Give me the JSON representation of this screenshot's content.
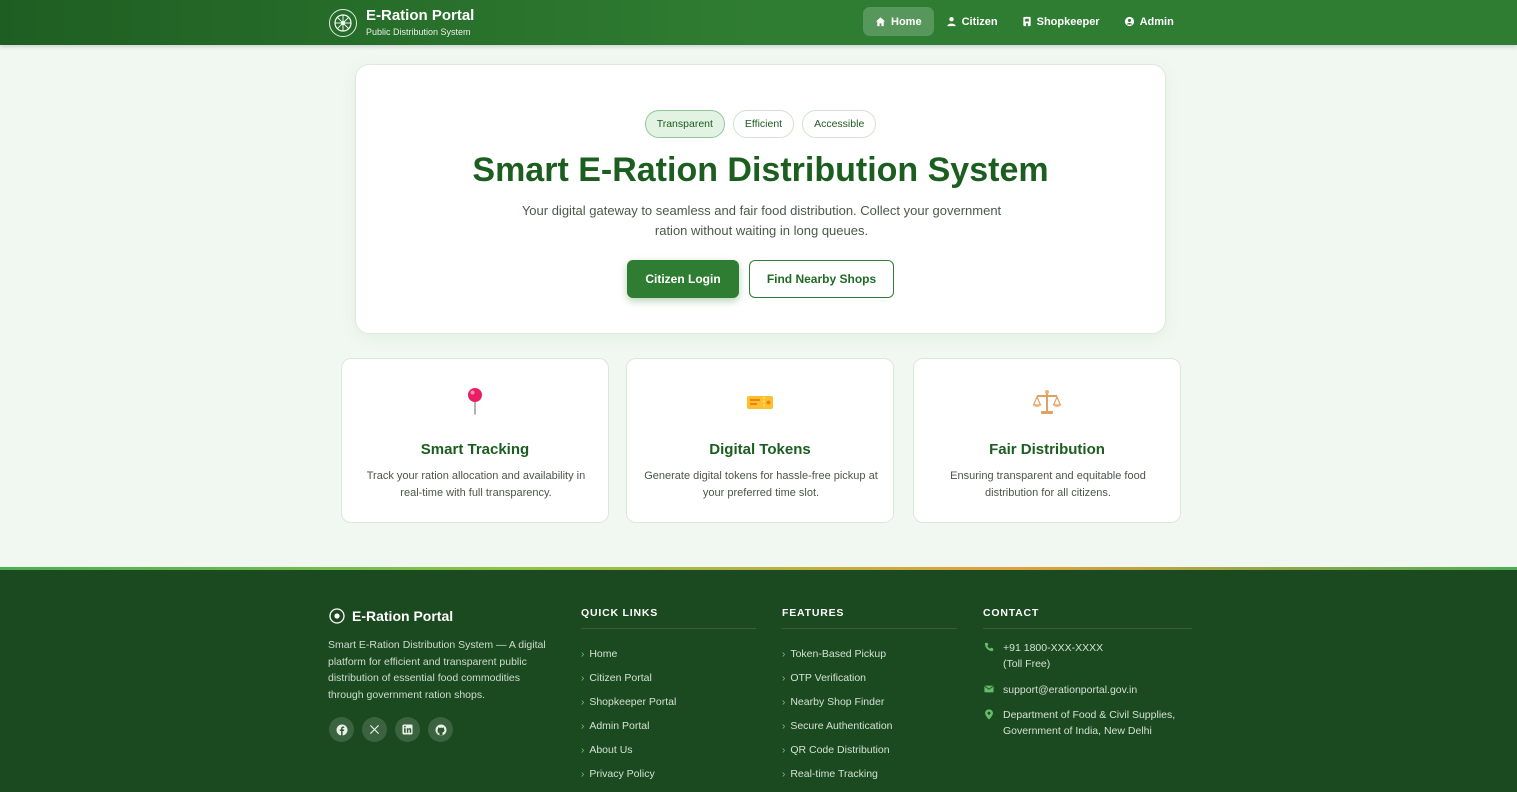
{
  "header": {
    "brand_title": "E-Ration Portal",
    "brand_subtitle": "Public Distribution System",
    "nav": [
      {
        "label": "Home",
        "active": true,
        "icon": "home-icon"
      },
      {
        "label": "Citizen",
        "active": false,
        "icon": "user-icon"
      },
      {
        "label": "Shopkeeper",
        "active": false,
        "icon": "store-icon"
      },
      {
        "label": "Admin",
        "active": false,
        "icon": "admin-icon"
      }
    ]
  },
  "hero": {
    "pills": [
      "Transparent",
      "Efficient",
      "Accessible"
    ],
    "title": "Smart E-Ration Distribution System",
    "description": "Your digital gateway to seamless and fair food distribution. Collect your government ration without waiting in long queues.",
    "primary_button": "Citizen Login",
    "secondary_button": "Find Nearby Shops"
  },
  "features": [
    {
      "icon": "pushpin-icon",
      "title": "Smart Tracking",
      "description": "Track your ration allocation and availability in real-time with full transparency."
    },
    {
      "icon": "ticket-icon",
      "title": "Digital Tokens",
      "description": "Generate digital tokens for hassle-free pickup at your preferred time slot."
    },
    {
      "icon": "balance-scale-icon",
      "title": "Fair Distribution",
      "description": "Ensuring transparent and equitable food distribution for all citizens."
    }
  ],
  "footer": {
    "brand_name": "E-Ration Portal",
    "about": "Smart E-Ration Distribution System — A digital platform for efficient and transparent public distribution of essential food commodities through government ration shops.",
    "socials": [
      "facebook-icon",
      "x-icon",
      "linkedin-icon",
      "github-icon"
    ],
    "quick_links_title": "QUICK LINKS",
    "quick_links": [
      "Home",
      "Citizen Portal",
      "Shopkeeper Portal",
      "Admin Portal",
      "About Us",
      "Privacy Policy"
    ],
    "features_title": "FEATURES",
    "features": [
      "Token-Based Pickup",
      "OTP Verification",
      "Nearby Shop Finder",
      "Secure Authentication",
      "QR Code Distribution",
      "Real-time Tracking"
    ],
    "contact_title": "CONTACT",
    "phone": "+91 1800-XXX-XXXX",
    "phone_note": "(Toll Free)",
    "email": "support@erationportal.gov.in",
    "address": "Department of Food & Civil Supplies, Government of India, New Delhi"
  },
  "colors": {
    "primary": "#2e7d32",
    "primary_dark": "#1b5e20",
    "footer_bg": "#1b4a20",
    "accent_light": "#e3f3e3"
  }
}
